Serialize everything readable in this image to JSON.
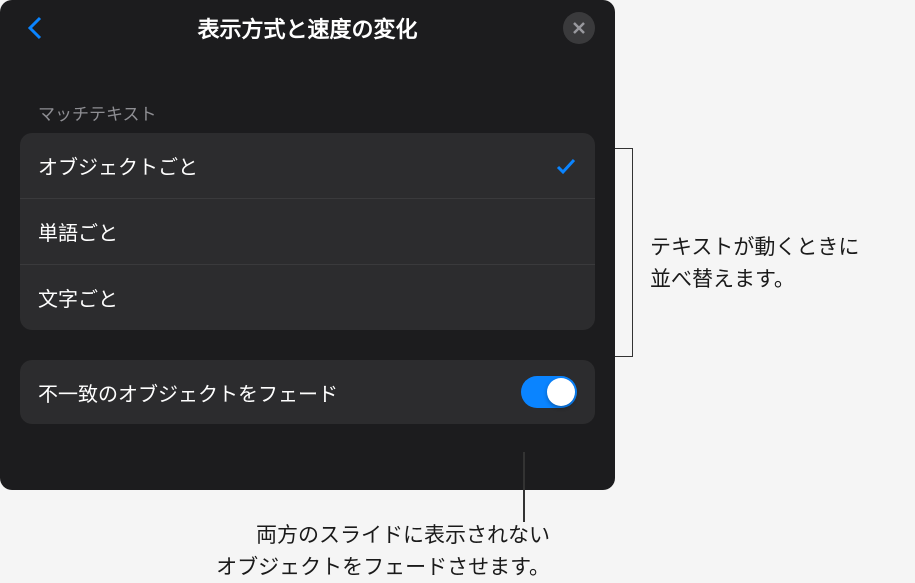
{
  "header": {
    "title": "表示方式と速度の変化"
  },
  "section": {
    "label": "マッチテキスト",
    "options": [
      {
        "label": "オブジェクトごと",
        "selected": true
      },
      {
        "label": "単語ごと",
        "selected": false
      },
      {
        "label": "文字ごと",
        "selected": false
      }
    ]
  },
  "toggle": {
    "label": "不一致のオブジェクトをフェード",
    "value": true
  },
  "callouts": {
    "text1_line1": "テキストが動くときに",
    "text1_line2": "並べ替えます。",
    "text2_line1": "両方のスライドに表示されない",
    "text2_line2": "オブジェクトをフェードさせます。"
  }
}
